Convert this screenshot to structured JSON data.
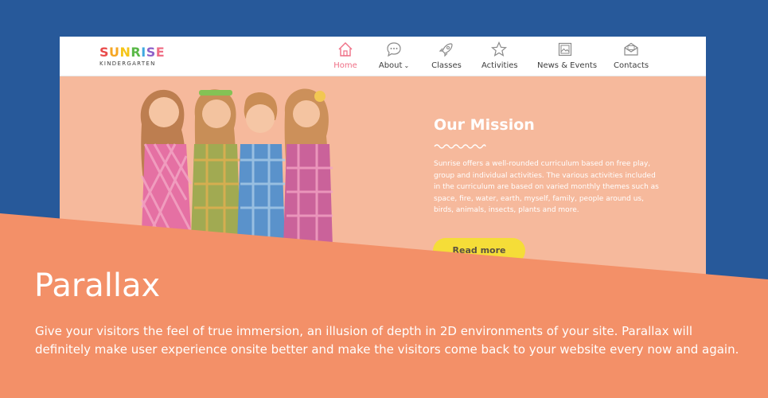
{
  "logo": {
    "title": "SUNRISE",
    "title_colors": [
      "#e94b4b",
      "#f6a623",
      "#f5c518",
      "#59b847",
      "#3fa9e0",
      "#8e62c9",
      "#ef6f86"
    ],
    "subtitle": "KINDERGARTEN"
  },
  "nav": {
    "items": [
      {
        "label": "Home",
        "icon": "house-icon",
        "active": true
      },
      {
        "label": "About",
        "icon": "speech-bubble-icon",
        "dropdown": true
      },
      {
        "label": "Classes",
        "icon": "rocket-icon"
      },
      {
        "label": "Activities",
        "icon": "star-icon"
      },
      {
        "label": "News & Events",
        "icon": "picture-frame-icon"
      },
      {
        "label": "Contacts",
        "icon": "envelope-icon"
      }
    ]
  },
  "mission": {
    "title": "Our Mission",
    "text": "Sunrise offers a well-rounded curriculum based on free play, group and individual activities. The various activities included in the curriculum are based on varied monthly themes such as space, fire, water, earth, myself, family, people around us, birds, animals, insects, plants and more.",
    "button": "Read more"
  },
  "banner": {
    "headline": "Parallax",
    "description": "Give your visitors the feel of true immersion, an illusion of depth in 2D environments of your site. Parallax will definitely make user experience onsite better and make the visitors come back to your website every now and again."
  },
  "colors": {
    "page_background": "#27599a",
    "hero_background": "#f6b99c",
    "banner": "#f39068",
    "accent_pink": "#ef6f86",
    "button_yellow": "#f5dd38"
  }
}
